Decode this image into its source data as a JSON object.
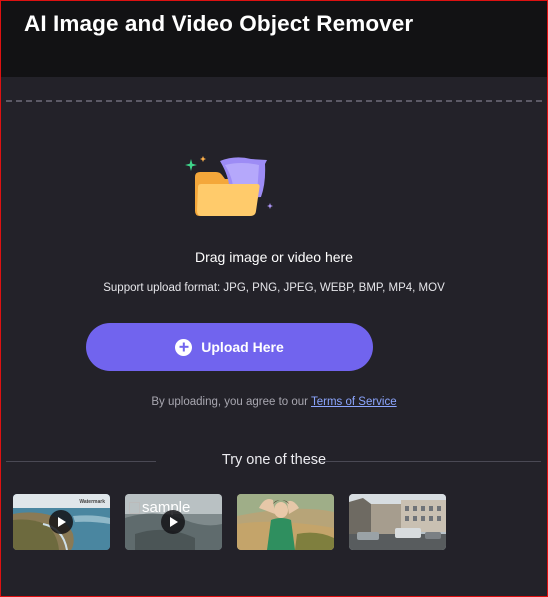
{
  "header": {
    "title": "AI Image and Video Object Remover"
  },
  "upload": {
    "drag_text": "Drag image or video here",
    "formats_text": "Support upload format: JPG, PNG, JPEG, WEBP, BMP, MP4, MOV",
    "button_label": "Upload Here",
    "agree_prefix": "By uploading, you agree to our",
    "terms_link": "Terms of Service"
  },
  "samples": {
    "heading": "Try one of these",
    "items": [
      {
        "kind": "video",
        "subject": "coastal cliff and ocean",
        "watermark": "Watermark"
      },
      {
        "kind": "video",
        "subject": "sample image (broken)",
        "alt_text": "sample"
      },
      {
        "kind": "image",
        "subject": "woman in green dress on hillside"
      },
      {
        "kind": "image",
        "subject": "city street with buildings and cars"
      }
    ]
  },
  "colors": {
    "background": "#232229",
    "header_bg": "#121214",
    "accent": "#7164ee",
    "link": "#8ca6ff",
    "border": "#dd1111"
  },
  "icons": [
    "folder-icon",
    "sparkle-icon",
    "plus-icon",
    "play-icon"
  ]
}
